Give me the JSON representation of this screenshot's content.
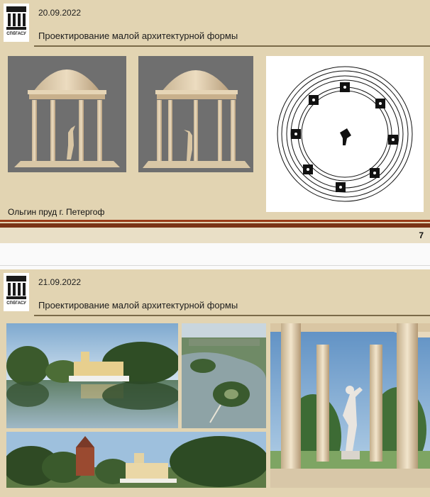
{
  "slides": [
    {
      "date": "20.09.2022",
      "title": "Проектирование малой архитектурной формы",
      "caption": "Ольгин пруд г. Петергоф",
      "page_number": "7",
      "logo": {
        "icon": "university-logo-icon",
        "text": "СПбГАСУ"
      }
    },
    {
      "date": "21.09.2022",
      "title": "Проектирование малой архитектурной формы",
      "logo": {
        "icon": "university-logo-icon",
        "text": "СПбГАСУ"
      }
    }
  ],
  "colors": {
    "slide_background": "#e2d4b2",
    "header_rule": "#7a6a48",
    "footer_bar": "#9a3c18",
    "render_background": "#6f6f6f"
  }
}
